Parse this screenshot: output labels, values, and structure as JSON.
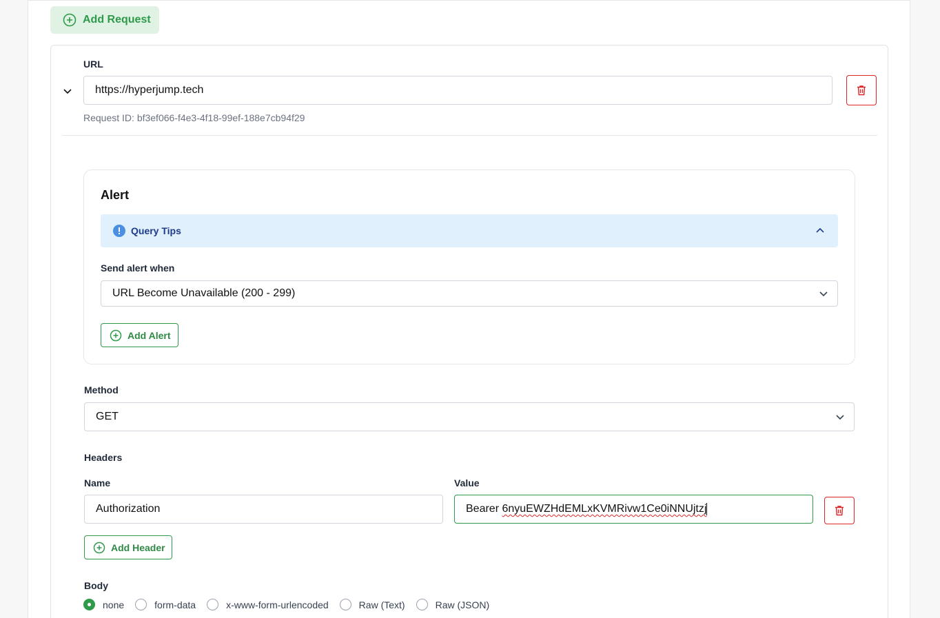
{
  "toolbar": {
    "add_request_label": "Add Request"
  },
  "request": {
    "url_label": "URL",
    "url_value": "https://hyperjump.tech",
    "request_id_text": "Request ID: bf3ef066-f4e3-4f18-99ef-188e7cb94f29",
    "alert": {
      "title": "Alert",
      "query_tips_label": "Query Tips",
      "send_alert_label": "Send alert when",
      "send_alert_value": "URL Become Unavailable (200 - 299)",
      "add_alert_label": "Add Alert"
    },
    "method_label": "Method",
    "method_value": "GET",
    "headers": {
      "title": "Headers",
      "name_label": "Name",
      "value_label": "Value",
      "name_value": "Authorization",
      "value_prefix": "Bearer ",
      "value_token": "6nyuEWZHdEMLxKVMRivw1Ce0iNNUjtzj",
      "add_header_label": "Add Header"
    },
    "body": {
      "title": "Body",
      "options": [
        "none",
        "form-data",
        "x-www-form-urlencoded",
        "Raw (Text)",
        "Raw (JSON)"
      ],
      "selected": "none"
    }
  },
  "colors": {
    "accent": "#2f9a4a",
    "danger": "#dc2626",
    "info_bg": "#e0f0fc"
  }
}
